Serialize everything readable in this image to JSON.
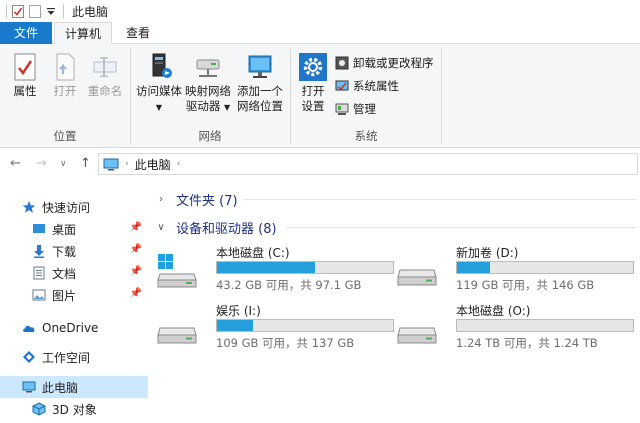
{
  "window": {
    "title": "此电脑"
  },
  "tabs": {
    "file": "文件",
    "computer": "计算机",
    "view": "查看"
  },
  "ribbon": {
    "location": {
      "label": "位置",
      "properties": "属性",
      "open": "打开",
      "rename": "重命名"
    },
    "network": {
      "label": "网络",
      "media_line1": "访问媒体",
      "map_line1": "映射网络",
      "map_line2": "驱动器",
      "add_line1": "添加一个",
      "add_line2": "网络位置"
    },
    "system": {
      "label": "系统",
      "open_line1": "打开",
      "open_line2": "设置",
      "uninstall": "卸载或更改程序",
      "sysprops": "系统属性",
      "manage": "管理"
    }
  },
  "address": {
    "path": "此电脑"
  },
  "sidebar": {
    "quick_access": "快速访问",
    "desktop": "桌面",
    "downloads": "下载",
    "documents": "文档",
    "pictures": "图片",
    "onedrive": "OneDrive",
    "workspace": "工作空间",
    "this_pc": "此电脑",
    "objects3d": "3D 对象"
  },
  "main": {
    "folders_header": "文件夹 (7)",
    "drives_header": "设备和驱动器 (8)",
    "drives": [
      {
        "name": "本地磁盘 (C:)",
        "info": "43.2 GB 可用，共 97.1 GB",
        "used": 0.555
      },
      {
        "name": "新加卷 (D:)",
        "info": "119 GB 可用，共 146 GB",
        "used": 0.185
      },
      {
        "name": "娱乐 (I:)",
        "info": "109 GB 可用，共 137 GB",
        "used": 0.204
      },
      {
        "name": "本地磁盘 (O:)",
        "info": "1.24 TB 可用，共 1.24 TB",
        "used": 0.0
      }
    ]
  },
  "colors": {
    "accent": "#1979ca",
    "bar_fill": "#26a0da",
    "selected": "#cce8ff"
  }
}
